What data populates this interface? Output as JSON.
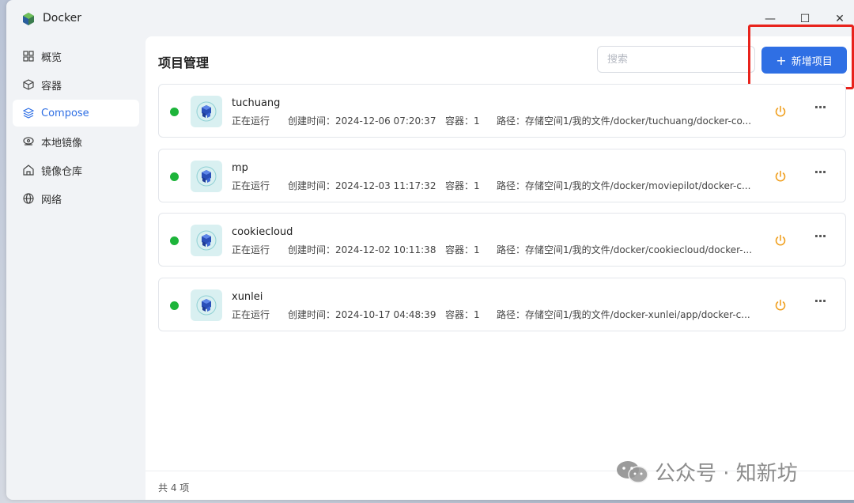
{
  "window": {
    "title": "Docker",
    "controls": {
      "minimize": "—",
      "maximize": "☐",
      "close": "✕"
    }
  },
  "sidebar": {
    "items": [
      {
        "label": "概览",
        "icon": "grid-icon",
        "active": false
      },
      {
        "label": "容器",
        "icon": "cube-icon",
        "active": false
      },
      {
        "label": "Compose",
        "icon": "layers-icon",
        "active": true
      },
      {
        "label": "本地镜像",
        "icon": "disk-icon",
        "active": false
      },
      {
        "label": "镜像仓库",
        "icon": "house-icon",
        "active": false
      },
      {
        "label": "网络",
        "icon": "globe-icon",
        "active": false
      }
    ]
  },
  "main": {
    "title": "项目管理",
    "search": {
      "placeholder": "搜索",
      "value": ""
    },
    "add_button": {
      "label": "新增项目",
      "icon": "plus-icon"
    },
    "projects": [
      {
        "name": "tuchuang",
        "status": "正在运行",
        "created": "创建时间：2024-12-06 07:20:37",
        "containers": "容器：1",
        "path": "路径：存储空间1/我的文件/docker/tuchuang/docker-co..."
      },
      {
        "name": "mp",
        "status": "正在运行",
        "created": "创建时间：2024-12-03 11:17:32",
        "containers": "容器：1",
        "path": "路径：存储空间1/我的文件/docker/moviepilot/docker-c..."
      },
      {
        "name": "cookiecloud",
        "status": "正在运行",
        "created": "创建时间：2024-12-02 10:11:38",
        "containers": "容器：1",
        "path": "路径：存储空间1/我的文件/docker/cookiecloud/docker-..."
      },
      {
        "name": "xunlei",
        "status": "正在运行",
        "created": "创建时间：2024-10-17 04:48:39",
        "containers": "容器：1",
        "path": "路径：存储空间1/我的文件/docker-xunlei/app/docker-c..."
      }
    ],
    "footer": "共 4 项"
  },
  "watermark": {
    "text": "公众号 · 知新坊"
  },
  "colors": {
    "accent": "#2f6fe4",
    "running": "#1db43a",
    "power": "#f0a020",
    "highlight": "#e8231c"
  }
}
